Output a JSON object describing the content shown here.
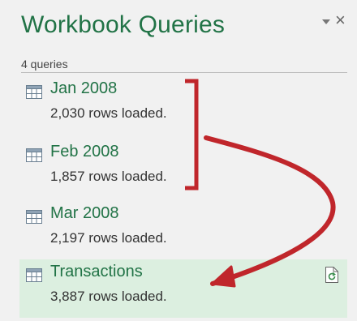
{
  "pane": {
    "title": "Workbook Queries",
    "query_count": "4 queries"
  },
  "queries": [
    {
      "name": "Jan 2008",
      "status": "2,030 rows loaded."
    },
    {
      "name": "Feb 2008",
      "status": "1,857 rows loaded."
    },
    {
      "name": "Mar 2008",
      "status": "2,197 rows loaded."
    },
    {
      "name": "Transactions",
      "status": "3,887 rows loaded.",
      "selected": true
    }
  ],
  "icons": {
    "table": "table-icon",
    "refresh": "refresh-icon",
    "close": "close-icon",
    "menu": "pane-options-icon"
  },
  "colors": {
    "accent": "#217346",
    "selected_bg": "#dcefe0",
    "annotation": "#c0262b"
  }
}
